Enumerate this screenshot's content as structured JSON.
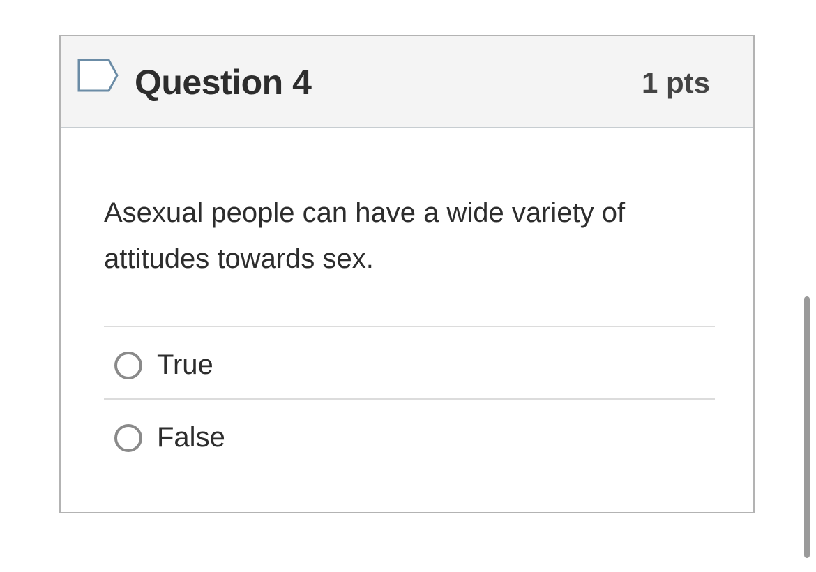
{
  "question": {
    "title": "Question 4",
    "points": "1 pts",
    "text": "Asexual people can have a wide variety of attitudes towards sex.",
    "flag_icon": "flag-outline-icon",
    "answers": [
      {
        "label": "True",
        "selected": false
      },
      {
        "label": "False",
        "selected": false
      }
    ]
  },
  "colors": {
    "header_background": "#f4f4f4",
    "border": "#b3b3b3",
    "text": "#2d2d2d",
    "radio_border": "#8a8a8a"
  }
}
